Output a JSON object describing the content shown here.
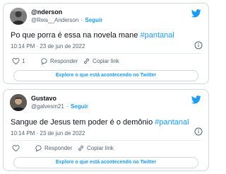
{
  "tweets": [
    {
      "display_name": "@nderson",
      "handle": "@Reis__Anderson",
      "dot": "·",
      "follow_label": "Seguir",
      "text_before": "Po que porra é essa na novela mane ",
      "hashtag": "#pantanal",
      "timestamp": "10:14 PM · 23 de jun de 2022",
      "like_count": "1",
      "reply_label": "Responder",
      "copy_label": "Copiar link",
      "explore_label": "Explore o que está acontecendo no Twitter"
    },
    {
      "display_name": "Gustavo",
      "handle": "@galvesm21",
      "dot": "·",
      "follow_label": "Seguir",
      "text_before": "Sangue de Jesus tem poder é o demônio ",
      "hashtag": "#pantanal",
      "timestamp": "10:14 PM · 23 de jun de 2022",
      "like_count": "",
      "reply_label": "Responder",
      "copy_label": "Copiar link",
      "explore_label": "Explore o que está acontecendo no Twitter"
    }
  ],
  "icons": {
    "brand": "twitter-bird-icon",
    "like": "heart-icon",
    "reply": "speech-bubble-icon",
    "copy": "link-icon",
    "info": "info-icon"
  },
  "colors": {
    "accent": "#1d9bf0",
    "text": "#0f1419",
    "muted": "#536471",
    "border": "#cfd9de"
  }
}
